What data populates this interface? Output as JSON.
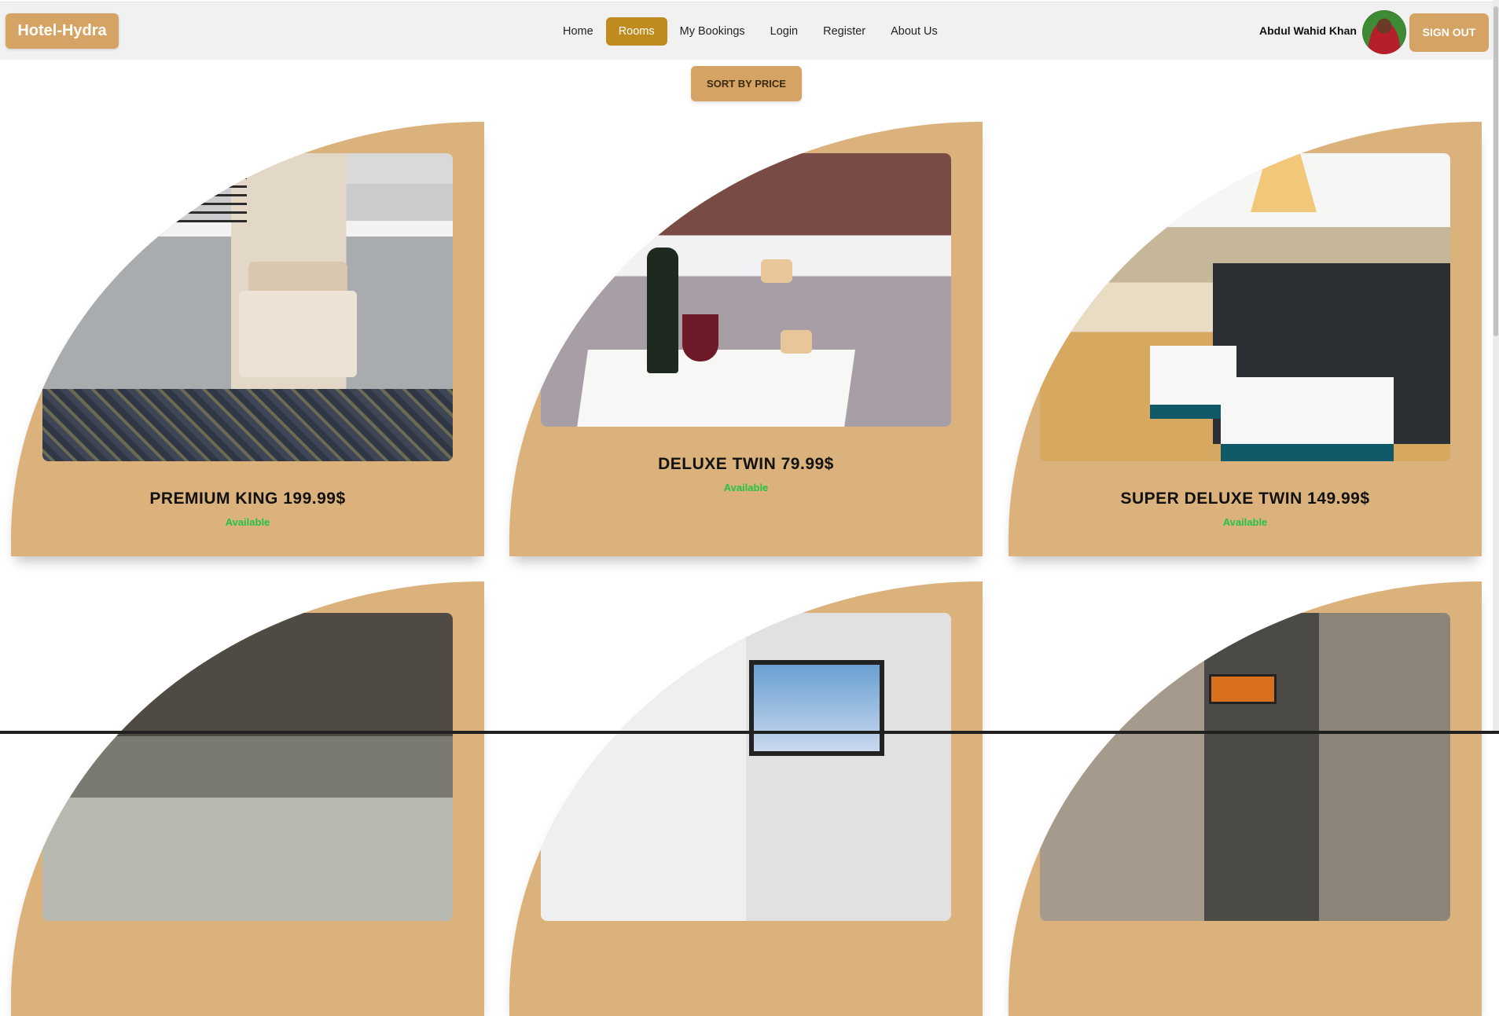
{
  "brand": "Hotel-Hydra",
  "nav": {
    "items": [
      "Home",
      "Rooms",
      "My Bookings",
      "Login",
      "Register",
      "About Us"
    ],
    "active": "Rooms"
  },
  "user": {
    "name": "Abdul Wahid Khan",
    "signout_label": "SIGN OUT"
  },
  "sort_label": "SORT BY PRICE",
  "rooms": [
    {
      "title": "PREMIUM KING 199.99$",
      "status": "Available"
    },
    {
      "title": "DELUXE TWIN 79.99$",
      "status": "Available"
    },
    {
      "title": "SUPER DELUXE TWIN 149.99$",
      "status": "Available"
    },
    {
      "title": "",
      "status": ""
    },
    {
      "title": "",
      "status": ""
    },
    {
      "title": "",
      "status": ""
    }
  ],
  "colors": {
    "accent": "#d5a364",
    "card_bg": "#dcb27c",
    "active_nav": "#bf8a1e",
    "available": "#22c443"
  }
}
